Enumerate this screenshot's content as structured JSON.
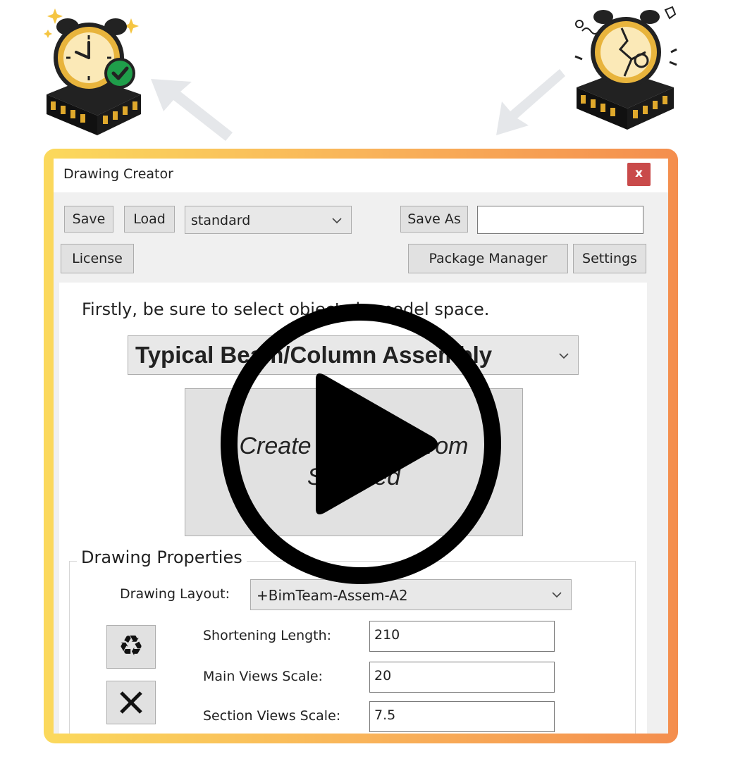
{
  "window": {
    "title": "Drawing Creator",
    "close_label": "x"
  },
  "toolbar": {
    "save_label": "Save",
    "load_label": "Load",
    "profile_select_value": "standard",
    "save_as_label": "Save As",
    "save_as_value": "",
    "license_label": "License",
    "package_manager_label": "Package Manager",
    "settings_label": "Settings"
  },
  "main": {
    "instruction": "Firstly, be sure to select objects in model space.",
    "assembly_type": "Typical Beam/Column Assembly",
    "create_button_line1": "Create Drawing From",
    "create_button_line2": "Selected"
  },
  "properties": {
    "group_title": "Drawing Properties",
    "layout_label": "Drawing Layout:",
    "layout_value": "+BimTeam-Assem-A2",
    "shortening_label": "Shortening Length:",
    "shortening_value": "210",
    "main_scale_label": "Main Views Scale:",
    "main_scale_value": "20",
    "section_scale_label": "Section Views Scale:",
    "section_scale_value": "7.5",
    "recycle_glyph": "♻",
    "clear_glyph": "✕"
  },
  "icons": {
    "top_left": "alarm-clock-checkmark-icon",
    "top_right": "broken-alarm-clock-icon",
    "overlay": "play-icon"
  },
  "colors": {
    "close": "#c94a4a",
    "frame_start": "#fbd95c",
    "frame_end": "#f48e4e",
    "check_green": "#1f9e4a"
  }
}
